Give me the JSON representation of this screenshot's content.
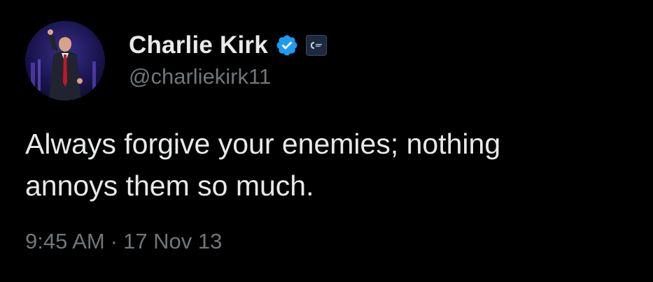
{
  "author": {
    "display_name": "Charlie Kirk",
    "handle": "@charliekirk11",
    "verified": true,
    "verified_color": "#1d9bf0",
    "avatar_icon": "profile-photo",
    "affiliate_badge_icon": "organization-badge-icon"
  },
  "tweet": {
    "text_line_1": "Always forgive your enemies; nothing",
    "text_line_2": "annoys them so much.",
    "time": "9:45 AM",
    "separator": "·",
    "date": "17 Nov 13"
  },
  "colors": {
    "background": "#000000",
    "primary_text": "#e7e9ea",
    "secondary_text": "#71767b"
  }
}
